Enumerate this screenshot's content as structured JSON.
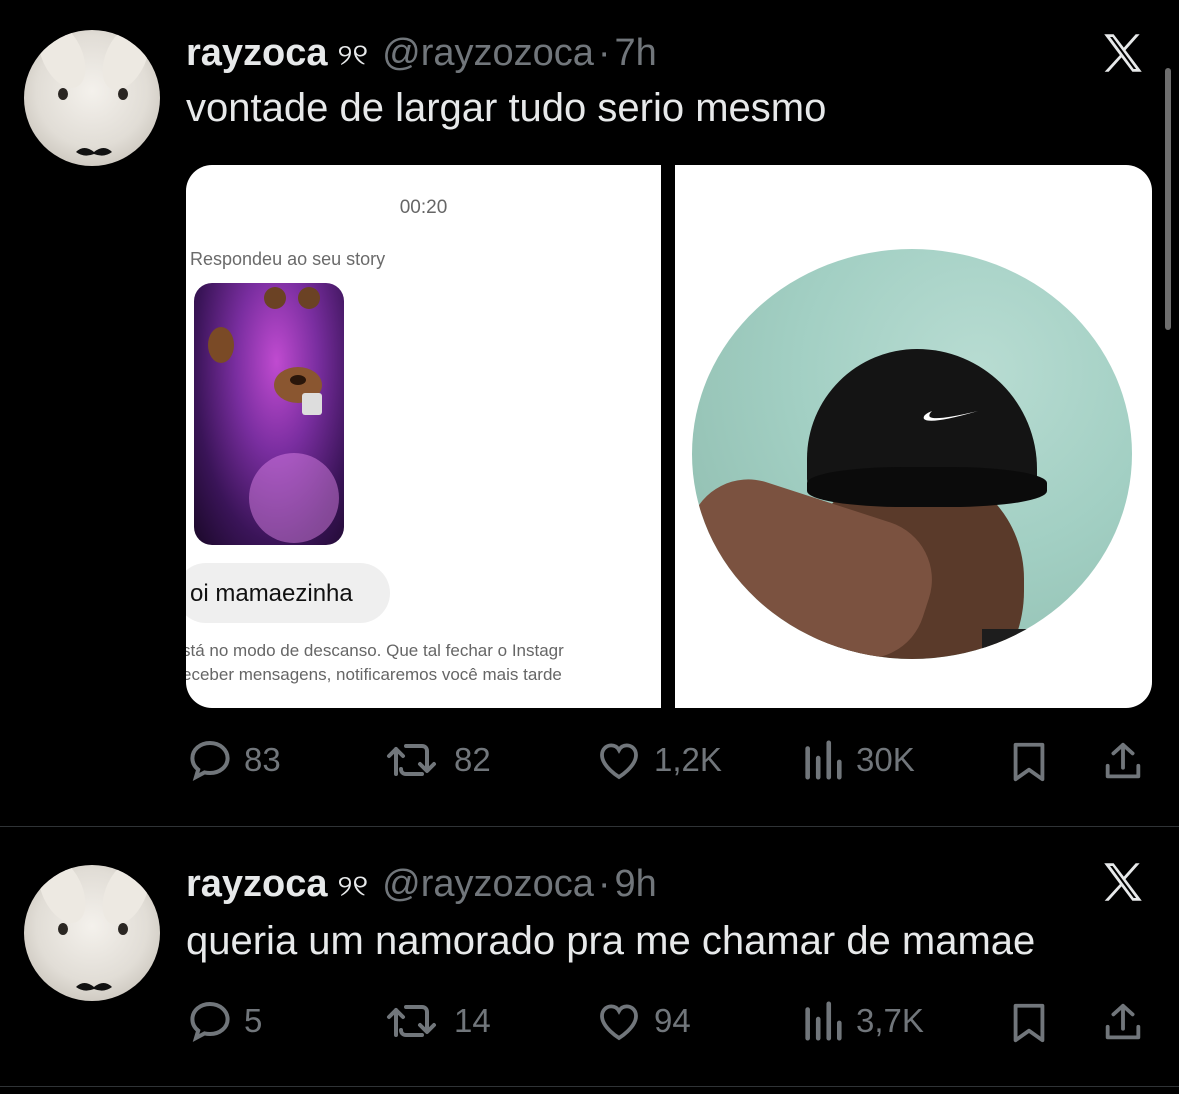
{
  "tweets": [
    {
      "author_name": "rayzoca",
      "name_decoration": "୨୧",
      "handle": "@rayzozoca",
      "separator": "·",
      "time": "7h",
      "text": "vontade de largar tudo serio mesmo",
      "media": {
        "left_screenshot": {
          "call_time": "00:20",
          "replied_label": "Respondeu ao seu story",
          "message": "oi mamaezinha",
          "notice_line1": "stá no modo de descanso. Que tal fechar o Instagr",
          "notice_line2": "eceber mensagens, notificaremos você mais tarde"
        }
      },
      "stats": {
        "replies": "83",
        "reposts": "82",
        "likes": "1,2K",
        "views": "30K"
      }
    },
    {
      "author_name": "rayzoca",
      "name_decoration": "୨୧",
      "handle": "@rayzozoca",
      "separator": "·",
      "time": "9h",
      "text": "queria um namorado pra me chamar de mamae",
      "stats": {
        "replies": "5",
        "reposts": "14",
        "likes": "94",
        "views": "3,7K"
      }
    }
  ],
  "icons": {
    "reply": "reply-icon",
    "repost": "repost-icon",
    "like": "heart-icon",
    "views": "views-icon",
    "bookmark": "bookmark-icon",
    "share": "share-icon",
    "platform": "x-logo-icon"
  },
  "colors": {
    "background": "#000000",
    "primary_text": "#e7e9ea",
    "secondary_text": "#71767b",
    "divider": "#2f3336"
  }
}
